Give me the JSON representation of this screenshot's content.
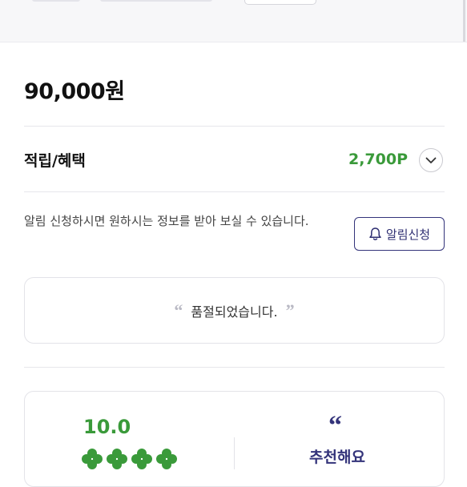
{
  "product": {
    "price": "90,000원"
  },
  "points": {
    "label": "적립/혜택",
    "value": "2,700P",
    "expand_icon": "chevron-down-icon"
  },
  "restock_alert": {
    "notice": "알림 신청하시면 원하시는 정보를 받아 보실 수 있습니다.",
    "button_label": "알림신청",
    "button_icon": "bell-icon"
  },
  "sold_out": {
    "open_quote": "“",
    "text": "품절되었습니다.",
    "close_quote": "”"
  },
  "review_summary": {
    "score": "10.0",
    "clover_rating": 4,
    "quote_mark": "“",
    "recommend_text": "추천해요"
  },
  "colors": {
    "accent_green": "#3a9a3a",
    "navy": "#33337a"
  }
}
